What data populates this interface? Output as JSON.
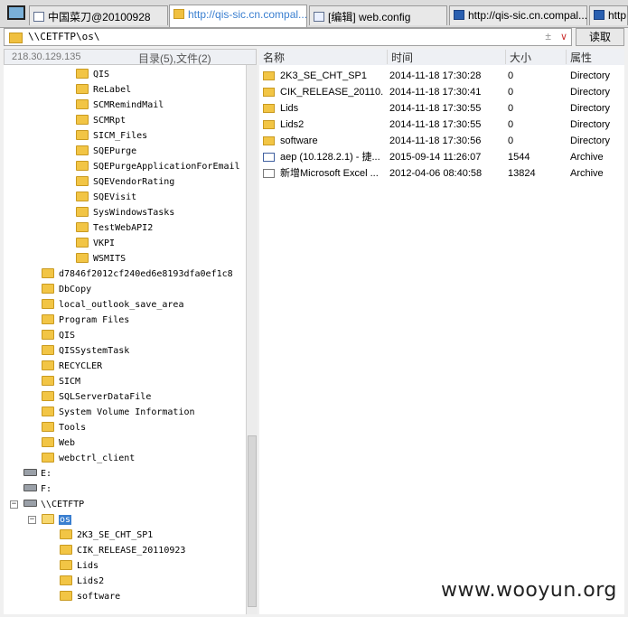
{
  "tabs": [
    {
      "label": "中国菜刀@20100928",
      "icon": "page-icon"
    },
    {
      "label": "http://qis-sic.cn.compal....",
      "icon": "folder-icon"
    },
    {
      "label": "[编辑] web.config",
      "icon": "doc-icon"
    },
    {
      "label": "http://qis-sic.cn.compal....",
      "icon": "web-icon"
    },
    {
      "label": "http:",
      "icon": "web-icon"
    }
  ],
  "address": {
    "path": "\\\\CETFTP\\os\\",
    "sep": "±",
    "caret": "∨"
  },
  "read_button": "读取",
  "left_header": {
    "ip": "218.30.129.135",
    "counts": "目录(5),文件(2)"
  },
  "tree": [
    {
      "label": "QIS"
    },
    {
      "label": "ReLabel"
    },
    {
      "label": "SCMRemindMail"
    },
    {
      "label": "SCMRpt"
    },
    {
      "label": "SICM_Files"
    },
    {
      "label": "SQEPurge"
    },
    {
      "label": "SQEPurgeApplicationForEmail"
    },
    {
      "label": "SQEVendorRating"
    },
    {
      "label": "SQEVisit"
    },
    {
      "label": "SysWindowsTasks"
    },
    {
      "label": "TestWebAPI2"
    },
    {
      "label": "VKPI"
    },
    {
      "label": "WSMITS"
    },
    {
      "label": "d7846f2012cf240ed6e8193dfa0ef1c8"
    },
    {
      "label": "DbCopy"
    },
    {
      "label": "local_outlook_save_area"
    },
    {
      "label": "Program Files"
    },
    {
      "label": "QIS"
    },
    {
      "label": "QISSystemTask"
    },
    {
      "label": "RECYCLER"
    },
    {
      "label": "SICM"
    },
    {
      "label": "SQLServerDataFile"
    },
    {
      "label": "System Volume Information"
    },
    {
      "label": "Tools"
    },
    {
      "label": "Web"
    },
    {
      "label": "webctrl_client"
    },
    {
      "label": "E:"
    },
    {
      "label": "F:"
    },
    {
      "label": "\\\\CETFTP",
      "expander": "−"
    },
    {
      "label": "os",
      "expander": "−"
    },
    {
      "label": "2K3_SE_CHT_SP1"
    },
    {
      "label": "CIK_RELEASE_20110923"
    },
    {
      "label": "Lids"
    },
    {
      "label": "Lids2"
    },
    {
      "label": "software"
    }
  ],
  "columns": {
    "name": "名称",
    "time": "时间",
    "size": "大小",
    "attr": "属性"
  },
  "files": [
    {
      "icon": "folder",
      "name": "2K3_SE_CHT_SP1",
      "time": "2014-11-18 17:30:28",
      "size": "0",
      "attr": "Directory"
    },
    {
      "icon": "folder",
      "name": "CIK_RELEASE_20110...",
      "time": "2014-11-18 17:30:41",
      "size": "0",
      "attr": "Directory"
    },
    {
      "icon": "folder",
      "name": "Lids",
      "time": "2014-11-18 17:30:55",
      "size": "0",
      "attr": "Directory"
    },
    {
      "icon": "folder",
      "name": "Lids2",
      "time": "2014-11-18 17:30:55",
      "size": "0",
      "attr": "Directory"
    },
    {
      "icon": "folder",
      "name": "software",
      "time": "2014-11-18 17:30:56",
      "size": "0",
      "attr": "Directory"
    },
    {
      "icon": "lnk",
      "name": "aep (10.128.2.1) - 捷...",
      "time": "2015-09-14 11:26:07",
      "size": "1544",
      "attr": "Archive"
    },
    {
      "icon": "file",
      "name": "新增Microsoft Excel ...",
      "time": "2012-04-06 08:40:58",
      "size": "13824",
      "attr": "Archive"
    }
  ],
  "watermark": "www.wooyun.org",
  "colors": {
    "accent": "#3a7fd0",
    "folder": "#f2c545"
  }
}
